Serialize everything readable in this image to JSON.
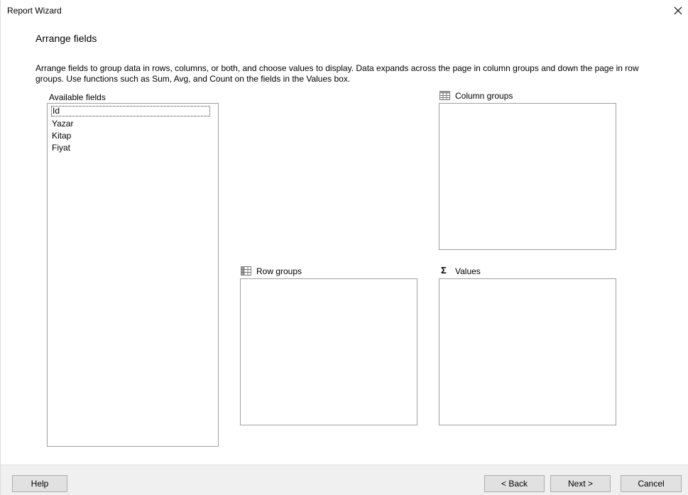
{
  "window": {
    "title": "Report Wizard",
    "close_icon": "close-icon"
  },
  "page": {
    "heading": "Arrange fields",
    "description": "Arrange fields to group data in rows, columns, or both, and choose values to display. Data expands across the page in column groups and down the page in row groups.  Use functions such as Sum, Avg, and Count on the fields in the Values box."
  },
  "available_fields": {
    "label": "Available fields",
    "items": [
      "Id",
      "Yazar",
      "Kitap",
      "Fiyat"
    ],
    "selected_index": 0
  },
  "column_groups": {
    "label": "Column groups",
    "icon": "table-grid-icon"
  },
  "row_groups": {
    "label": "Row groups",
    "icon": "table-grid-icon"
  },
  "values": {
    "label": "Values",
    "icon": "sigma-icon",
    "icon_glyph": "Σ"
  },
  "footer": {
    "help_label": "Help",
    "back_label": "< Back",
    "next_label": "Next >",
    "cancel_label": "Cancel"
  }
}
